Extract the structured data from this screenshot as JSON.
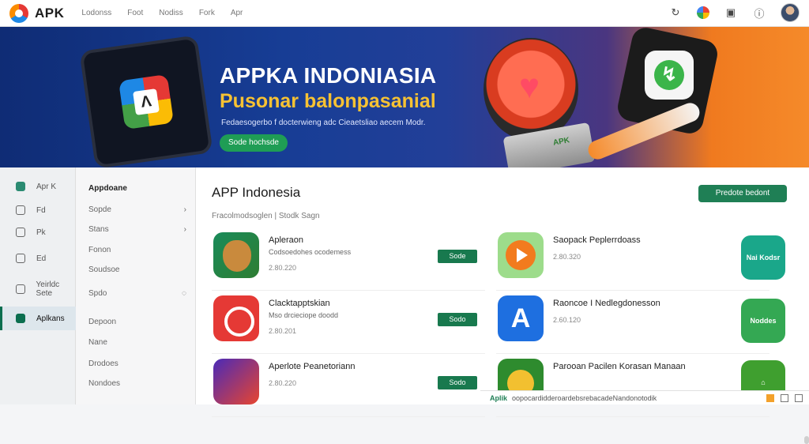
{
  "header": {
    "brand": "APK",
    "nav": [
      "Lodonss",
      "Foot",
      "Nodiss",
      "Fork",
      "Apr"
    ]
  },
  "banner": {
    "title": "APPKA INDONIASIA",
    "subtitle": "Pusonar balonpasanial",
    "description": "Fedaesogerbo f docterwieng adc Cieaetsliao aecem Modr.",
    "cta": "Sode hochsde",
    "tablet_app_letter": "Λ",
    "cup_label": "APK",
    "phone_app_letter": "↯"
  },
  "sidebar": {
    "items": [
      "Apr K",
      "Fd",
      "Pk",
      "Ed",
      "Yeirldc Sete",
      "Aplkans"
    ],
    "active_index": 5
  },
  "subnav": {
    "head": "Appdoane",
    "items": [
      "Sopde",
      "Stans",
      "Fonon",
      "Soudsoe",
      "Spdo",
      "Depoon",
      "Nane",
      "Drodoes",
      "Nondoes"
    ]
  },
  "main": {
    "title": "APP Indonesia",
    "subtitle": "Fracolmodsoglen  | Stodk Sagn",
    "cta": "Predote bedont"
  },
  "apps": [
    {
      "name": "Apleraon",
      "desc": "Codsoedohes ocodemess",
      "meta": "2.80.220",
      "get": "Sode"
    },
    {
      "name": "Clacktapptskian",
      "desc": "Mso drcieciope doodd",
      "meta": "2.80.201",
      "get": "Sodo"
    },
    {
      "name": "Aperlote Peanetoriann",
      "desc": "",
      "meta": "2.80.220",
      "get": "Sodo"
    },
    {
      "name": "Saopack Peplerrdoass",
      "desc": "",
      "meta": "2.80.320",
      "get": ""
    },
    {
      "name": "Raoncoe I Nedlegdonesson",
      "desc": "",
      "meta": "2.60.120",
      "get": ""
    },
    {
      "name": "Parooan Pacilen Korasan Manaan",
      "desc": "",
      "meta": "",
      "get": ""
    }
  ],
  "right_badges": [
    "Nai Kodsr",
    "Noddes",
    ""
  ],
  "footer": {
    "brand": "Aplik",
    "text": "oopocardidderoardebsrebacadeNandonotodik"
  },
  "colors": {
    "accent": "#1f7f55",
    "banner_dark": "#0f2c75",
    "banner_orange": "#f58a2a",
    "title_yellow": "#f7c233"
  }
}
